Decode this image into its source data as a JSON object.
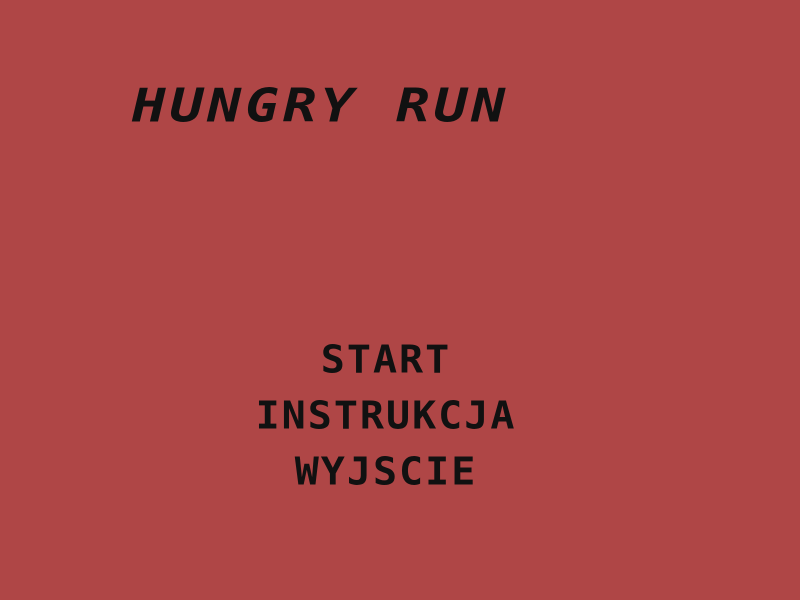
{
  "game": {
    "title": "HUNGRY RUN"
  },
  "menu": {
    "items": [
      {
        "label": "START"
      },
      {
        "label": "INSTRUKCJA"
      },
      {
        "label": "WYJSCIE"
      }
    ]
  },
  "colors": {
    "background": "#af4646",
    "text": "#111111"
  }
}
